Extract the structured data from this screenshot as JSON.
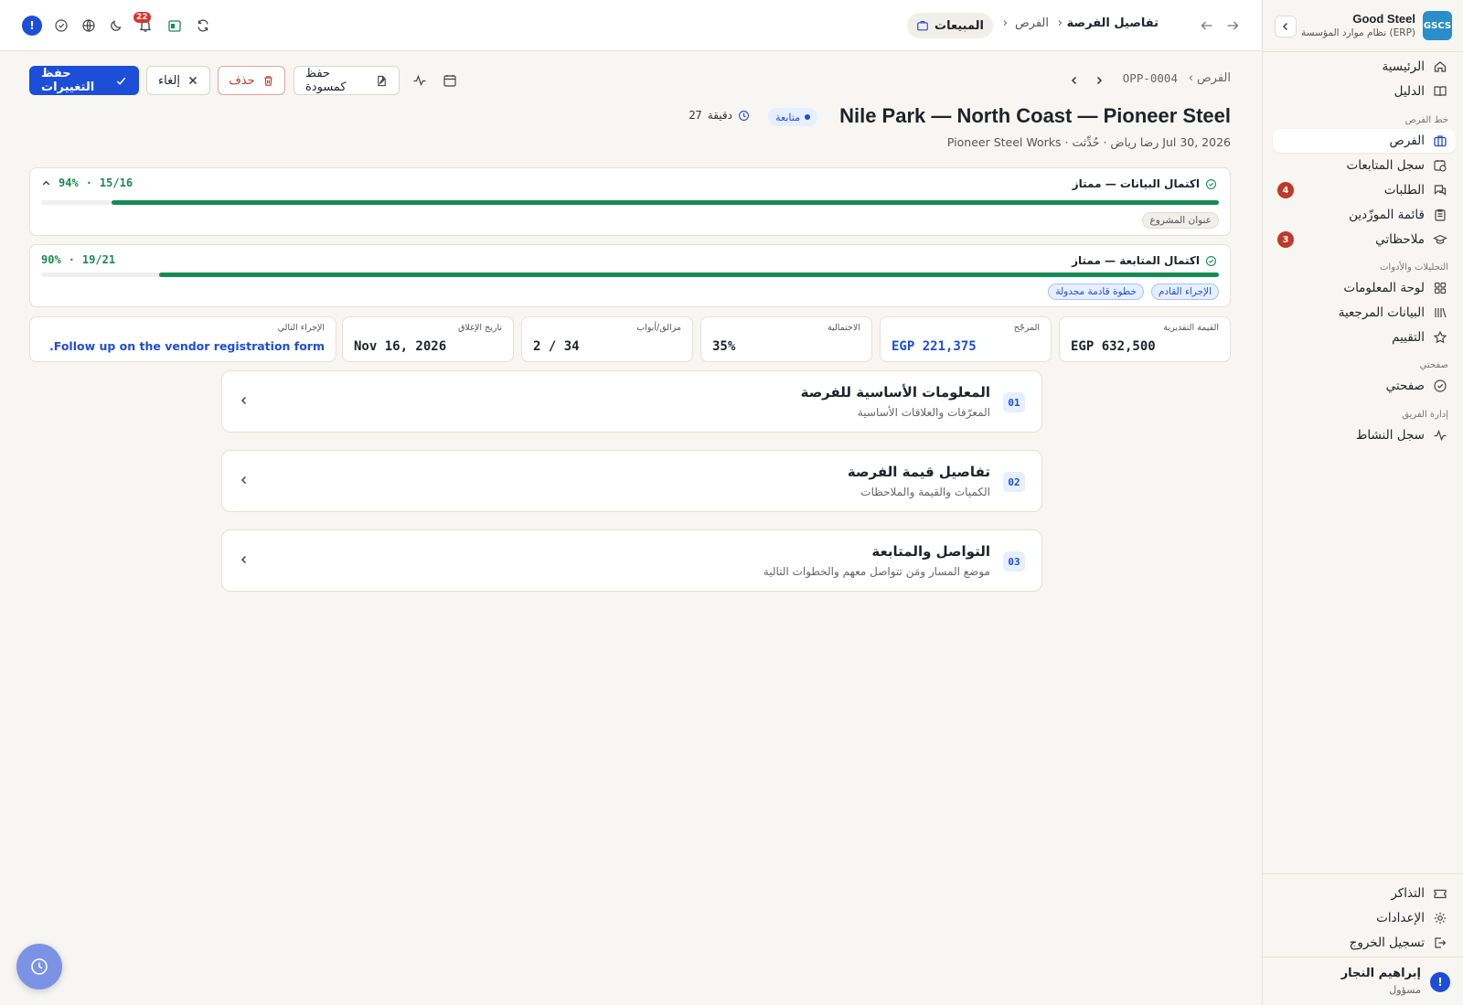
{
  "brand": {
    "logo": "GSCS",
    "name": "Good Steel",
    "subtitle": "نظام موارد المؤسسة (ERP)"
  },
  "sidebar": {
    "top_items": [
      {
        "label": "الرئيسية",
        "icon": "home-icon"
      },
      {
        "label": "الدليل",
        "icon": "book-icon"
      }
    ],
    "group_pipeline": "خط الفرص",
    "pipeline_items": [
      {
        "label": "الفرص",
        "icon": "briefcase-icon",
        "active": true
      },
      {
        "label": "سجل المتابعات",
        "icon": "calendar-clock-icon"
      },
      {
        "label": "الطلبات",
        "icon": "chat-icon",
        "badge": "4"
      },
      {
        "label": "قائمة الموزّدين",
        "icon": "clipboard-icon"
      },
      {
        "label": "ملاحظاتي",
        "icon": "graduation-icon",
        "badge": "3"
      }
    ],
    "group_tools": "التحليلات والأدوات",
    "tool_items": [
      {
        "label": "لوحة المعلومات",
        "icon": "dashboard-icon"
      },
      {
        "label": "البيانات المرجعية",
        "icon": "library-icon"
      },
      {
        "label": "التقييم",
        "icon": "star-icon"
      }
    ],
    "group_mypage": "صفحتي",
    "mypage_items": [
      {
        "label": "صفحتي",
        "icon": "check-circle-icon"
      }
    ],
    "group_team": "إدارة الفريق",
    "team_items": [
      {
        "label": "سجل النشاط",
        "icon": "activity-icon"
      }
    ],
    "bottom_items": [
      {
        "label": "التذاكر",
        "icon": "ticket-icon"
      },
      {
        "label": "الإعدادات",
        "icon": "gear-icon"
      },
      {
        "label": "تسجيل الخروج",
        "icon": "logout-icon"
      }
    ],
    "user": {
      "name": "إبراهيم النجار",
      "role": "مسؤول",
      "avatar": "!"
    }
  },
  "topbar": {
    "section": "المبيعات",
    "crumb_opps": "الفرص",
    "crumb_current": "تفاصيل الفرصة",
    "notifications": "22",
    "alert": "!"
  },
  "toolbar": {
    "save": "حفظ التغييرات",
    "cancel": "إلغاء",
    "delete": "حذف",
    "draft": "حفظ كمسودة"
  },
  "page": {
    "crumb_root": "الفرص",
    "opp_id": "OPP-0004",
    "title": "Nile Park — North Coast — Pioneer Steel",
    "status": "متابعة",
    "timer_value": "27",
    "timer_unit": "دقيقة",
    "subtitle": "Pioneer Steel Works · رضا رياض · حُدِّثت Jul 30, 2026"
  },
  "progress": [
    {
      "title": "اكتمال البيانات — ممتاز",
      "count": "15/16",
      "percent_text": "94%",
      "fraction": 0.94,
      "chips": [
        {
          "label": "عنوان المشروع",
          "style": "gray"
        }
      ]
    },
    {
      "title": "اكتمال المتابعة — ممتاز",
      "count": "19/21",
      "percent_text": "90%",
      "fraction": 0.9,
      "chips": [
        {
          "label": "الإجراء القادم",
          "style": "blue"
        },
        {
          "label": "خطوة قادمة مجدولة",
          "style": "blue"
        }
      ]
    }
  ],
  "stats": [
    {
      "label": "القيمة التقديرية",
      "value": "EGP 632,500",
      "color": "#1f2328"
    },
    {
      "label": "المرجّح",
      "value": "EGP 221,375",
      "color": "#1d4ed8"
    },
    {
      "label": "الاحتمالية",
      "value": "35%",
      "color": "#1f2328"
    },
    {
      "label": "مزالق/أبواب",
      "value": "2 / 34",
      "color": "#1f2328"
    },
    {
      "label": "تاريخ الإغلاق",
      "value": "Nov 16, 2026",
      "color": "#1f2328"
    },
    {
      "label": "الإجراء التالي",
      "value": "Follow up on the vendor registration form.",
      "color": "#1d4ed8"
    }
  ],
  "sections": [
    {
      "num": "01",
      "title": "المعلومات الأساسية للفرصة",
      "subtitle": "المعرّفات والعلاقات الأساسية"
    },
    {
      "num": "02",
      "title": "تفاصيل قيمة الفرصة",
      "subtitle": "الكميات والقيمة والملاحظات"
    },
    {
      "num": "03",
      "title": "التواصل والمتابعة",
      "subtitle": "موضع المسار ومَن تتواصل معهم والخطوات التالية"
    }
  ],
  "colors": {
    "accent": "#1d4ed8",
    "success": "#168a55",
    "danger": "#c0392b"
  }
}
